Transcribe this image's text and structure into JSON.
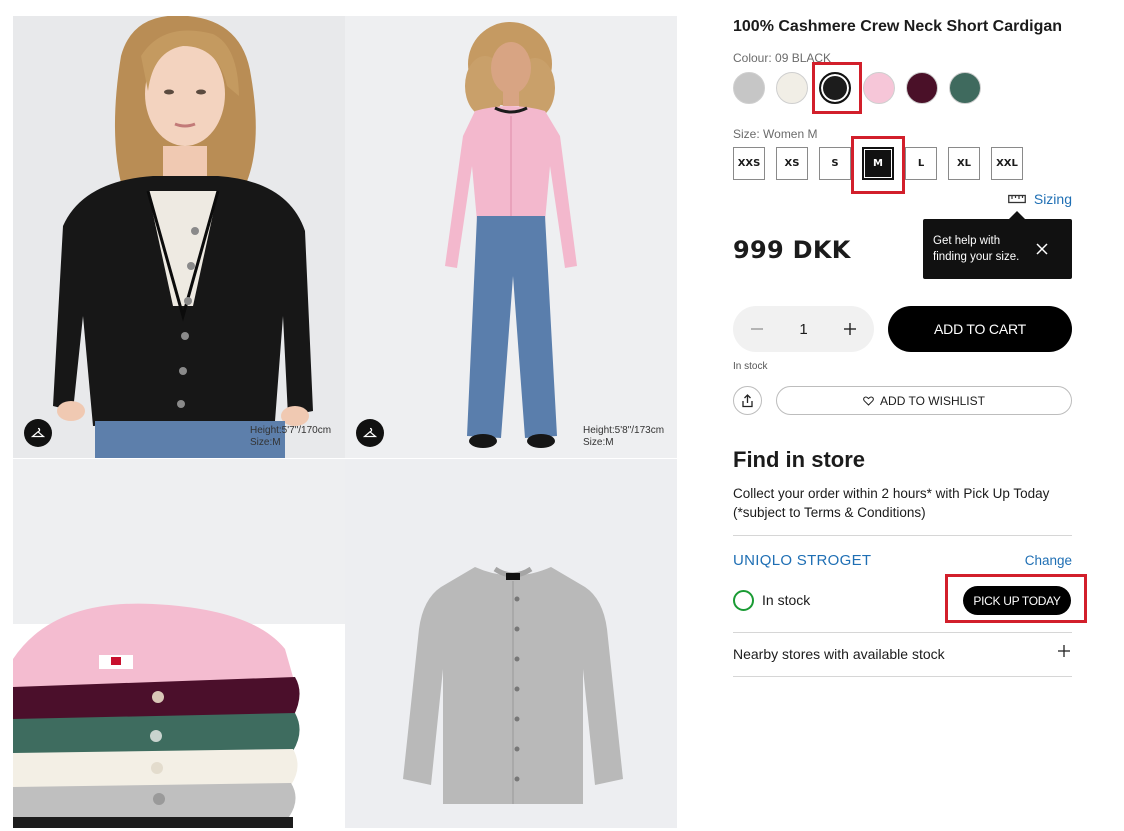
{
  "product": {
    "title": "100% Cashmere Crew Neck Short Cardigan",
    "colour_label": "Colour:",
    "colour_value": "09 BLACK",
    "size_label": "Size:",
    "size_value": "Women M",
    "sizing_link": "Sizing",
    "price": "999 DKK",
    "quantity": "1",
    "add_to_cart": "ADD TO CART",
    "stock_status": "In stock",
    "add_to_wishlist": "ADD TO WISHLIST"
  },
  "colours": [
    {
      "name": "grey",
      "hex": "#c6c6c6"
    },
    {
      "name": "off-white",
      "hex": "#f1eee6"
    },
    {
      "name": "black",
      "hex": "#1c1c1c",
      "selected": true
    },
    {
      "name": "pink",
      "hex": "#f6c6d8"
    },
    {
      "name": "wine",
      "hex": "#4a1028"
    },
    {
      "name": "green",
      "hex": "#3f6a5e"
    }
  ],
  "sizes": [
    {
      "label": "XXS"
    },
    {
      "label": "XS"
    },
    {
      "label": "S"
    },
    {
      "label": "M",
      "selected": true
    },
    {
      "label": "L"
    },
    {
      "label": "XL"
    },
    {
      "label": "XXL"
    }
  ],
  "tooltip": {
    "line1": "Get help with",
    "line2": "finding your size."
  },
  "gallery": {
    "image1_model_info_line1": "Height:5'7\"/170cm",
    "image1_model_info_line2": "Size:M",
    "image2_model_info_line1": "Height:5'8\"/173cm",
    "image2_model_info_line2": "Size:M"
  },
  "find_in_store": {
    "title": "Find in store",
    "description": "Collect your order within 2 hours* with Pick Up Today (*subject to Terms & Conditions)",
    "store_name": "UNIQLO STROGET",
    "change_link": "Change",
    "stock_status": "In stock",
    "pickup_button": "PICK UP TODAY",
    "nearby_label": "Nearby stores with available stock"
  },
  "colors": {
    "accent_link": "#1f6fb4",
    "instock_green": "#1a9b34",
    "highlight_red": "#d21f2b",
    "primary_button": "#000000"
  }
}
